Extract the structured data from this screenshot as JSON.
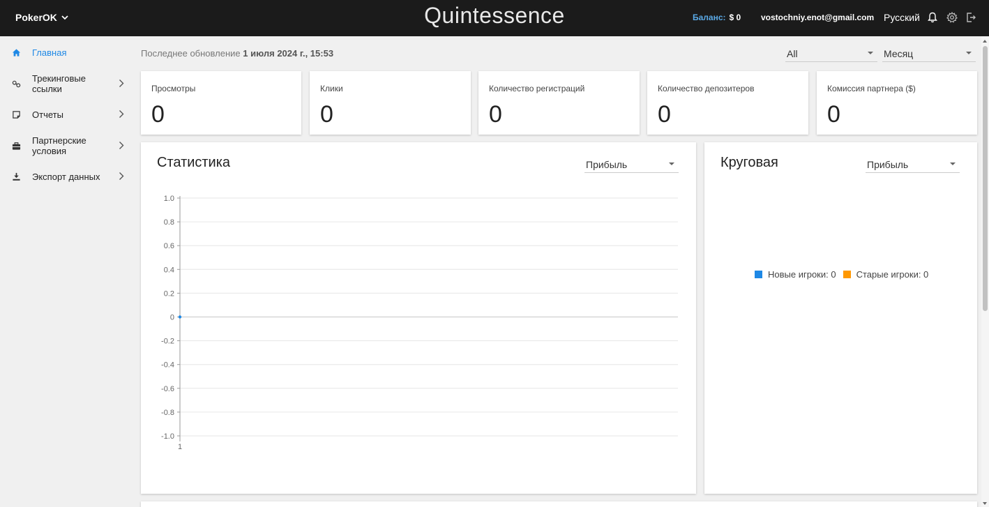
{
  "header": {
    "brand": "PokerOK",
    "app_title": "Quintessence",
    "balance_label": "Баланс:",
    "balance_value": "$ 0",
    "user_email": "vostochniy.enot@gmail.com",
    "language": "Русский",
    "icons": [
      "bell-icon",
      "gear-icon",
      "logout-icon"
    ]
  },
  "sidebar": {
    "items": [
      {
        "label": "Главная",
        "icon": "home-icon",
        "active": true
      },
      {
        "label": "Трекинговые ссылки",
        "icon": "link-icon"
      },
      {
        "label": "Отчеты",
        "icon": "report-icon"
      },
      {
        "label": "Партнерские условия",
        "icon": "briefcase-icon"
      },
      {
        "label": "Экспорт данных",
        "icon": "download-icon"
      }
    ]
  },
  "main": {
    "last_update_label": "Последнее обновление",
    "last_update_value": "1 июля 2024 г., 15:53",
    "filter_all": "All",
    "filter_period": "Месяц",
    "kpis": [
      {
        "label": "Просмотры",
        "value": "0"
      },
      {
        "label": "Клики",
        "value": "0"
      },
      {
        "label": "Количество регистраций",
        "value": "0"
      },
      {
        "label": "Количество депозитеров",
        "value": "0"
      },
      {
        "label": "Комиссия партнера ($)",
        "value": "0"
      }
    ],
    "stats_title": "Статистика",
    "stats_metric": "Прибыль",
    "pie_title": "Круговая",
    "pie_metric": "Прибыль",
    "pie_legend": [
      {
        "label": "Новые игроки: 0",
        "color": "#1e88e5"
      },
      {
        "label": "Старые игроки: 0",
        "color": "#ff9800"
      }
    ]
  },
  "chart_data": {
    "type": "line",
    "x": [
      1
    ],
    "series": [
      {
        "values": [
          0
        ]
      }
    ],
    "xticks": [
      "1"
    ],
    "yticks": [
      "1.0",
      "0.8",
      "0.6",
      "0.4",
      "0.2",
      "0",
      "-0.2",
      "-0.4",
      "-0.6",
      "-0.8",
      "-1.0"
    ],
    "ylim": [
      -1.0,
      1.0
    ],
    "grid": true,
    "colors": {
      "line": "#1e88e5"
    }
  }
}
